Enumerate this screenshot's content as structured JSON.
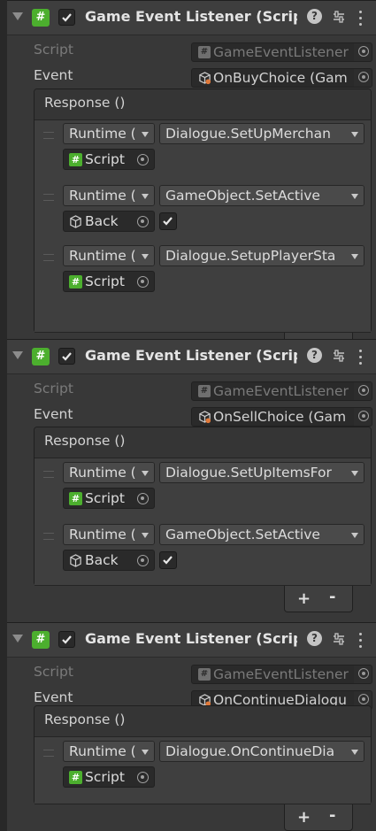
{
  "components": [
    {
      "title": "Game Event Listener (Script",
      "script_label": "Script",
      "script_value": "GameEventListener",
      "event_label": "Event",
      "event_value": "OnBuyChoice (Gam",
      "response_label": "Response ()",
      "responses": [
        {
          "mode": "Runtime (",
          "function": "Dialogue.SetUpMerchan",
          "target": "Script",
          "has_bool": false
        },
        {
          "mode": "Runtime (",
          "function": "GameObject.SetActive",
          "target": "Back",
          "has_bool": true
        },
        {
          "mode": "Runtime (",
          "function": "Dialogue.SetupPlayerSta",
          "target": "Script",
          "has_bool": false
        }
      ]
    },
    {
      "title": "Game Event Listener (Script",
      "script_label": "Script",
      "script_value": "GameEventListener",
      "event_label": "Event",
      "event_value": "OnSellChoice (Gam",
      "response_label": "Response ()",
      "responses": [
        {
          "mode": "Runtime (",
          "function": "Dialogue.SetUpItemsFor",
          "target": "Script",
          "has_bool": false
        },
        {
          "mode": "Runtime (",
          "function": "GameObject.SetActive",
          "target": "Back",
          "has_bool": true
        }
      ]
    },
    {
      "title": "Game Event Listener (Script",
      "script_label": "Script",
      "script_value": "GameEventListener",
      "event_label": "Event",
      "event_value": "OnContinueDialogu",
      "response_label": "Response ()",
      "responses": [
        {
          "mode": "Runtime (",
          "function": "Dialogue.OnContinueDia",
          "target": "Script",
          "has_bool": false
        }
      ]
    }
  ],
  "icons": {
    "script": "csharp-script-icon",
    "gameobject": "cube-icon",
    "scriptable_object": "scriptable-object-icon",
    "help": "help-icon",
    "preset": "preset-icon",
    "menu": "kebab-menu-icon"
  },
  "colors": {
    "background": "#383838",
    "script_badge": "#4caf2e",
    "text": "#d2d2d2",
    "dim_text": "#7a7a7a"
  },
  "list_controls": {
    "add": "+",
    "remove": "-"
  },
  "badge_glyph": "#",
  "help_glyph": "?"
}
